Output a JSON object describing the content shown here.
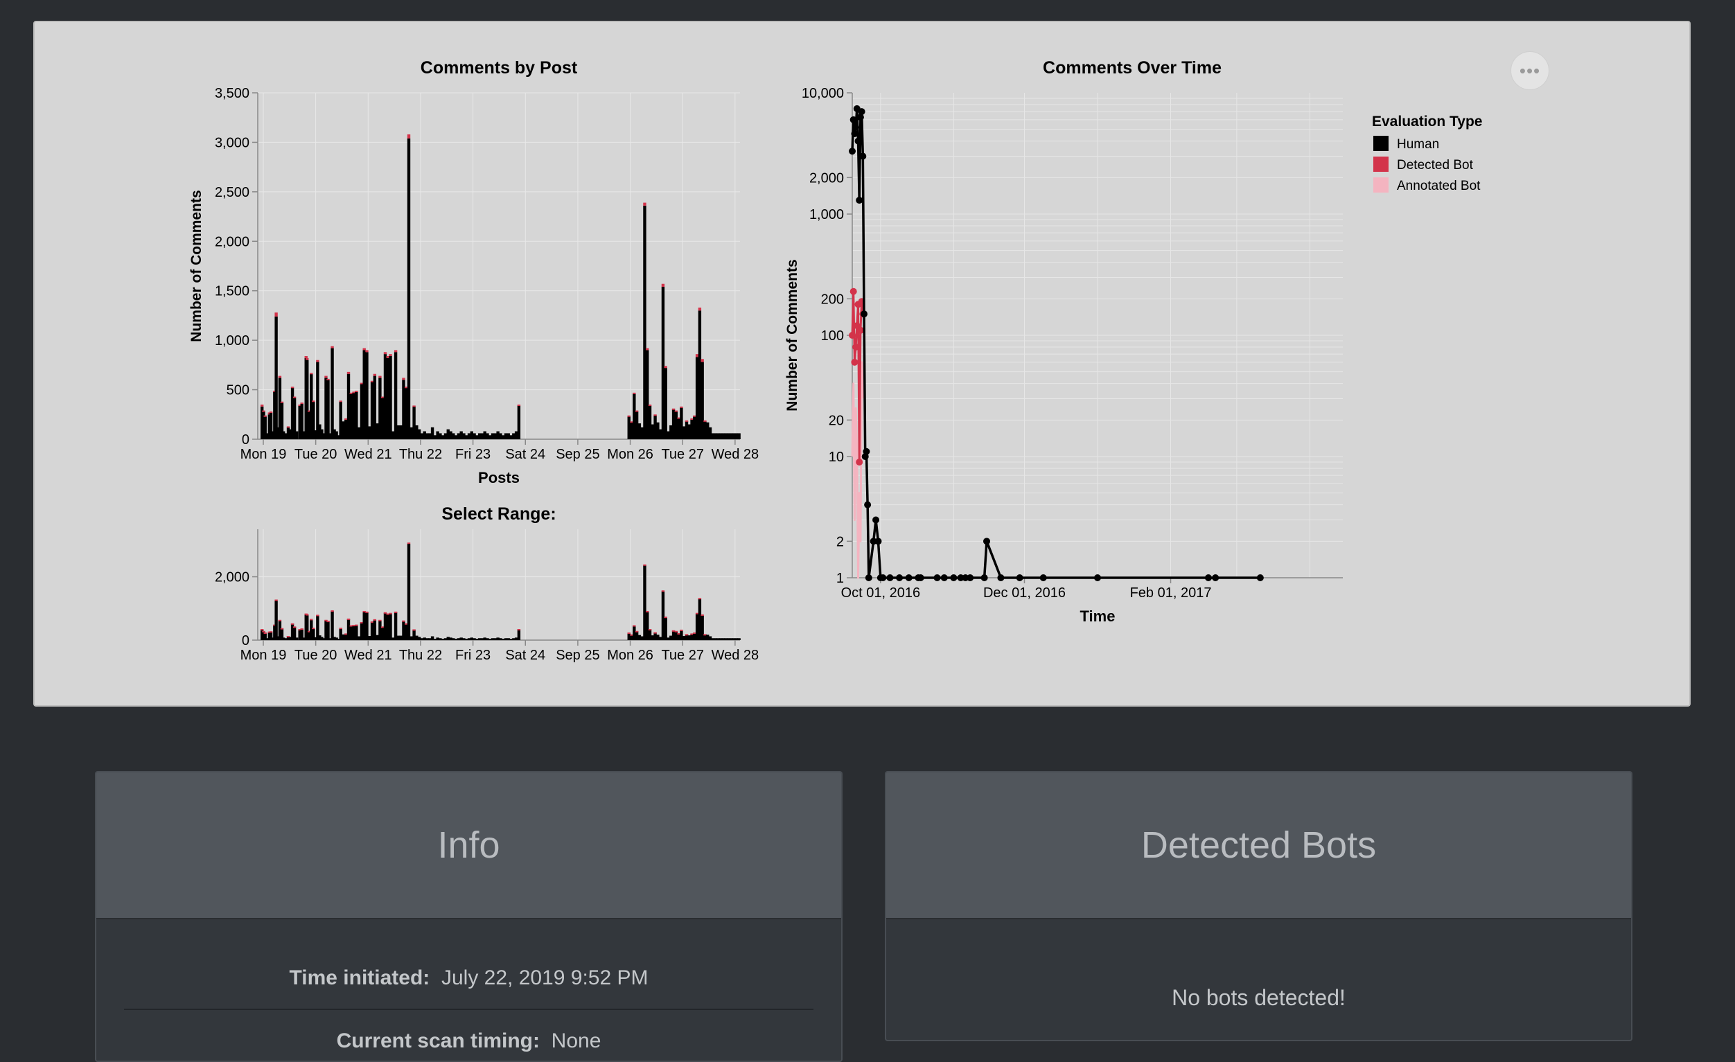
{
  "chart_data": [
    {
      "type": "bar",
      "title": "Comments by Post",
      "xlabel": "Posts",
      "ylabel": "Number of Comments",
      "ylim": [
        0,
        3500
      ],
      "y_ticks": [
        "0",
        "500",
        "1,000",
        "1,500",
        "2,000",
        "2,500",
        "3,000",
        "3,500"
      ],
      "x_ticks": [
        "Mon 19",
        "Tue 20",
        "Wed 21",
        "Thu 22",
        "Fri 23",
        "Sat 24",
        "Sep 25",
        "Mon 26",
        "Tue 27",
        "Wed 28"
      ],
      "series": [
        {
          "name": "Human",
          "color": "#000000"
        },
        {
          "name": "Detected Bot",
          "color": "#d3334a"
        },
        {
          "name": "Annotated Bot",
          "color": "#f4b4c0"
        }
      ],
      "day_positions": [
        0,
        0.03,
        0.06,
        0.1,
        0.14,
        0.17,
        0.2,
        0.24,
        0.27,
        0.3,
        0.34,
        0.38,
        0.41,
        0.45,
        0.5,
        0.55,
        0.58,
        0.62,
        0.66,
        0.72,
        0.76,
        0.8,
        0.84,
        0.86,
        0.9,
        0.94,
        0.98,
        1.02,
        1.06,
        1.1,
        1.14,
        1.18,
        1.22,
        1.26,
        1.3,
        1.34,
        1.38,
        1.42,
        1.46,
        1.5,
        1.55,
        1.6,
        1.65,
        1.7,
        1.75,
        1.8,
        1.85,
        1.9,
        1.95,
        2.0,
        2.05,
        2.1,
        2.15,
        2.2,
        2.25,
        2.3,
        2.35,
        2.4,
        2.45,
        2.5,
        2.55,
        2.6,
        2.65,
        2.7,
        2.75,
        2.8,
        2.85,
        2.9,
        2.95,
        3.0,
        3.05,
        3.1,
        3.15,
        3.2,
        3.25,
        3.3,
        3.35,
        3.4,
        3.45,
        3.5,
        3.55,
        3.6,
        3.65,
        3.7,
        3.75,
        3.8,
        3.85,
        3.9,
        3.95,
        4.0,
        4.05,
        4.1,
        4.15,
        4.2,
        4.25,
        4.3,
        4.35,
        4.4,
        4.45,
        4.5,
        4.55,
        4.6,
        4.65,
        4.7,
        4.75,
        4.8,
        4.85,
        4.9,
        7.0,
        7.05,
        7.1,
        7.15,
        7.2,
        7.25,
        7.3,
        7.35,
        7.4,
        7.45,
        7.5,
        7.55,
        7.6,
        7.65,
        7.7,
        7.75,
        7.8,
        7.85,
        7.9,
        7.95,
        8.0,
        8.05,
        8.1,
        8.15,
        8.2,
        8.25,
        8.3,
        8.35,
        8.4,
        8.45,
        8.5,
        8.55,
        8.6,
        8.65,
        8.7,
        8.75,
        8.8,
        8.85,
        8.9,
        8.95,
        9.0,
        9.05,
        9.1
      ],
      "values": [
        330,
        280,
        230,
        60,
        250,
        270,
        80,
        480,
        1240,
        120,
        620,
        370,
        80,
        60,
        120,
        100,
        520,
        420,
        80,
        340,
        360,
        80,
        820,
        800,
        280,
        660,
        380,
        90,
        780,
        150,
        100,
        60,
        620,
        600,
        60,
        920,
        100,
        80,
        40,
        380,
        180,
        200,
        660,
        460,
        470,
        480,
        120,
        560,
        900,
        880,
        130,
        580,
        640,
        160,
        620,
        420,
        860,
        820,
        840,
        80,
        880,
        140,
        140,
        600,
        520,
        3040,
        120,
        330,
        140,
        100,
        60,
        80,
        60,
        60,
        120,
        40,
        80,
        60,
        40,
        60,
        100,
        80,
        60,
        40,
        60,
        80,
        60,
        40,
        60,
        80,
        60,
        40,
        60,
        60,
        80,
        60,
        40,
        60,
        60,
        80,
        60,
        40,
        60,
        60,
        40,
        60,
        80,
        340,
        230,
        170,
        460,
        280,
        160,
        120,
        2360,
        900,
        340,
        150,
        240,
        170,
        100,
        1540,
        720,
        80,
        140,
        300,
        280,
        210,
        320,
        130,
        180,
        150,
        200,
        230,
        830,
        1300,
        780,
        180,
        170,
        120,
        60,
        60,
        60,
        60,
        60,
        60,
        60,
        60,
        60,
        60,
        60
      ],
      "bot_values": [
        20,
        10,
        10,
        0,
        20,
        10,
        0,
        10,
        40,
        0,
        20,
        10,
        0,
        0,
        10,
        0,
        10,
        10,
        0,
        10,
        10,
        0,
        20,
        20,
        10,
        10,
        10,
        0,
        20,
        0,
        0,
        0,
        20,
        10,
        0,
        20,
        0,
        0,
        0,
        10,
        0,
        10,
        20,
        10,
        10,
        10,
        0,
        10,
        20,
        20,
        0,
        10,
        20,
        0,
        20,
        10,
        20,
        20,
        20,
        0,
        20,
        0,
        0,
        20,
        10,
        40,
        0,
        10,
        0,
        0,
        0,
        0,
        0,
        0,
        0,
        0,
        0,
        0,
        0,
        0,
        0,
        0,
        0,
        0,
        0,
        0,
        0,
        0,
        0,
        0,
        0,
        0,
        0,
        0,
        0,
        0,
        0,
        0,
        0,
        0,
        0,
        0,
        0,
        0,
        0,
        0,
        0,
        10,
        10,
        10,
        10,
        10,
        0,
        0,
        30,
        20,
        10,
        0,
        10,
        0,
        0,
        30,
        20,
        0,
        0,
        10,
        10,
        10,
        10,
        0,
        10,
        0,
        10,
        10,
        30,
        30,
        30,
        10,
        0,
        0,
        0,
        0,
        0,
        0,
        0,
        0,
        0,
        0,
        0,
        0,
        0
      ]
    },
    {
      "type": "bar",
      "title": "Select Range:",
      "y_ticks": [
        "0",
        "2,000"
      ],
      "ylim": [
        0,
        3500
      ],
      "x_ticks": [
        "Mon 19",
        "Tue 20",
        "Wed 21",
        "Thu 22",
        "Fri 23",
        "Sat 24",
        "Sep 25",
        "Mon 26",
        "Tue 27",
        "Wed 28"
      ]
    },
    {
      "type": "line",
      "title": "Comments Over Time",
      "xlabel": "Time",
      "ylabel": "Number of Comments",
      "y_scale": "log",
      "ylim": [
        1,
        10000
      ],
      "y_ticks": [
        "1",
        "2",
        "10",
        "20",
        "100",
        "200",
        "1,000",
        "2,000",
        "10,000"
      ],
      "x_ticks": [
        "Oct 01, 2016",
        "Dec 01, 2016",
        "Feb 01, 2017"
      ],
      "xlim": [
        "2016-09-19",
        "2017-04-15"
      ],
      "legend": {
        "title": "Evaluation Type",
        "position": "right",
        "items": [
          {
            "label": "Human",
            "color": "#000000"
          },
          {
            "label": "Detected Bot",
            "color": "#d3334a"
          },
          {
            "label": "Annotated Bot",
            "color": "#f4b4c0"
          }
        ]
      },
      "series": [
        {
          "name": "Human",
          "color": "#000000",
          "points": [
            [
              "2016-09-19",
              3300
            ],
            [
              "2016-09-19T12",
              6000
            ],
            [
              "2016-09-20",
              4600
            ],
            [
              "2016-09-20T12",
              5200
            ],
            [
              "2016-09-21",
              7400
            ],
            [
              "2016-09-21T12",
              4000
            ],
            [
              "2016-09-22",
              1300
            ],
            [
              "2016-09-22T12",
              6300
            ],
            [
              "2016-09-23",
              7000
            ],
            [
              "2016-09-23T12",
              3000
            ],
            [
              "2016-09-24",
              150
            ],
            [
              "2016-09-24T12",
              10
            ],
            [
              "2016-09-25",
              11
            ],
            [
              "2016-09-25T12",
              4
            ],
            [
              "2016-09-26",
              1
            ],
            [
              "2016-09-28",
              2
            ],
            [
              "2016-09-29",
              3
            ],
            [
              "2016-09-30",
              2
            ],
            [
              "2016-10-01",
              1
            ],
            [
              "2016-10-02",
              1
            ],
            [
              "2016-10-05",
              1
            ],
            [
              "2016-10-09",
              1
            ],
            [
              "2016-10-13",
              1
            ],
            [
              "2016-10-17",
              1
            ],
            [
              "2016-10-18",
              1
            ],
            [
              "2016-10-25",
              1
            ],
            [
              "2016-10-28",
              1
            ],
            [
              "2016-11-01",
              1
            ],
            [
              "2016-11-04",
              1
            ],
            [
              "2016-11-06",
              1
            ],
            [
              "2016-11-08",
              1
            ],
            [
              "2016-11-14",
              1
            ],
            [
              "2016-11-15",
              2
            ],
            [
              "2016-11-21",
              1
            ],
            [
              "2016-11-29",
              1
            ],
            [
              "2016-12-09",
              1
            ],
            [
              "2017-01-01",
              1
            ],
            [
              "2017-02-17",
              1
            ],
            [
              "2017-02-20",
              1
            ],
            [
              "2017-03-11",
              1
            ]
          ]
        },
        {
          "name": "Detected Bot",
          "color": "#d3334a",
          "points": [
            [
              "2016-09-19",
              100
            ],
            [
              "2016-09-19T12",
              230
            ],
            [
              "2016-09-20",
              60
            ],
            [
              "2016-09-20T12",
              80
            ],
            [
              "2016-09-21",
              120
            ],
            [
              "2016-09-21T12",
              180
            ],
            [
              "2016-09-22",
              9
            ],
            [
              "2016-09-22T12",
              110
            ],
            [
              "2016-09-23",
              190
            ],
            [
              "2016-09-23T12",
              150
            ]
          ]
        },
        {
          "name": "Annotated Bot",
          "color": "#f4b4c0",
          "points": [
            [
              "2016-09-19",
              10
            ],
            [
              "2016-09-19T12",
              40
            ],
            [
              "2016-09-20",
              3
            ],
            [
              "2016-09-20T12",
              25
            ],
            [
              "2016-09-21",
              11
            ],
            [
              "2016-09-21T12",
              1
            ],
            [
              "2016-09-22",
              5
            ],
            [
              "2016-09-22T12",
              2
            ],
            [
              "2016-09-23",
              60
            ],
            [
              "2016-09-23T12",
              30
            ]
          ]
        }
      ]
    }
  ],
  "menu": {
    "label": "•••"
  },
  "info": {
    "title": "Info",
    "time_label": "Time initiated:",
    "time_value": "July 22, 2019 9:52 PM",
    "scan_label": "Current scan timing:",
    "scan_value": "None"
  },
  "bots": {
    "title": "Detected Bots",
    "empty_text": "No bots detected!"
  }
}
